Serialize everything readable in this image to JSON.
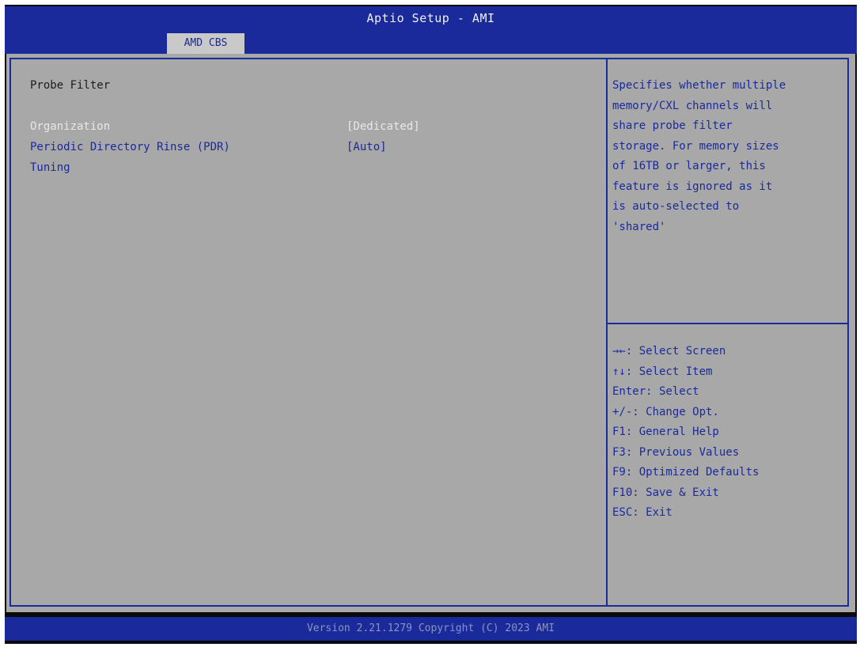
{
  "header": {
    "title": "Aptio Setup - AMI",
    "tab_label": "AMD CBS"
  },
  "main": {
    "section_title": "Probe Filter",
    "items": [
      {
        "label": "Organization",
        "value": "[Dedicated]"
      },
      {
        "label": "Periodic Directory Rinse (PDR)",
        "value": "[Auto]"
      },
      {
        "label": "Tuning",
        "value": ""
      }
    ]
  },
  "help": {
    "lines": [
      "Specifies whether multiple",
      "memory/CXL channels will",
      "share probe filter",
      "storage. For memory sizes",
      "of 16TB or larger, this",
      "feature is ignored as it",
      "is auto-selected to",
      "'shared'"
    ]
  },
  "keys": {
    "lines": [
      "→←: Select Screen",
      "↑↓: Select Item",
      "Enter: Select",
      "+/-: Change Opt.",
      "F1: General Help",
      "F3: Previous Values",
      "F9: Optimized Defaults",
      "F10: Save & Exit",
      "ESC: Exit"
    ]
  },
  "footer": {
    "text": "Version 2.21.1279 Copyright (C) 2023 AMI"
  },
  "colors": {
    "header_blue": "#1a2a9a",
    "panel_gray": "#a8a8a8",
    "selected_text": "#e8e8e8"
  }
}
